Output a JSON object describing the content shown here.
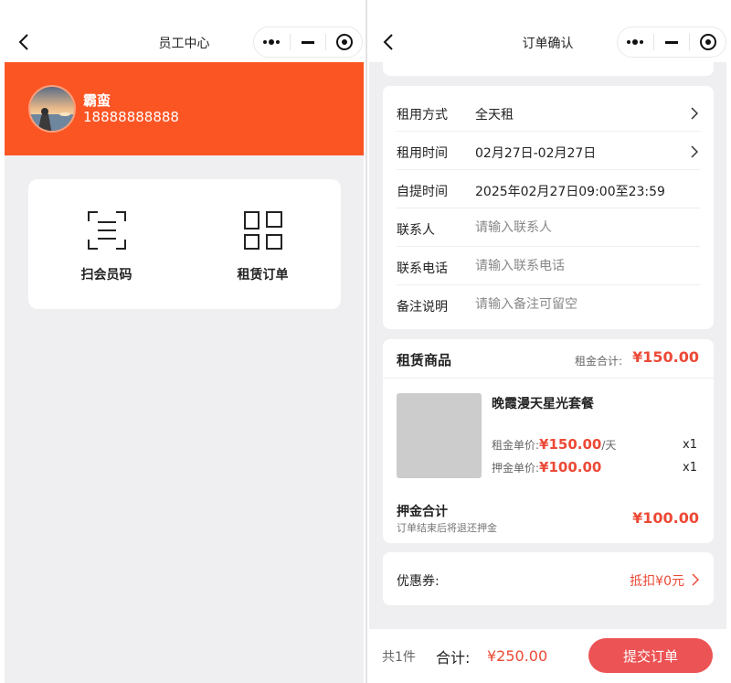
{
  "colors": {
    "brand_orange": "#fb5524",
    "accent_red": "#ec4936",
    "submit_button": "#ec5354",
    "page_background": "#efeff1"
  },
  "left_screen": {
    "nav": {
      "title": "员工中心",
      "back_icon": "chevron-left-icon",
      "capsule_icons": [
        "more-dots-icon",
        "minimize-icon",
        "target-icon"
      ]
    },
    "profile": {
      "name": "霸蛮",
      "phone": "18888888888",
      "avatar_icon": "avatar-photo"
    },
    "menu": [
      {
        "label": "扫会员码",
        "icon": "scan-icon"
      },
      {
        "label": "租赁订单",
        "icon": "grid-icon"
      }
    ]
  },
  "right_screen": {
    "nav": {
      "title": "订单确认",
      "back_icon": "chevron-left-icon",
      "capsule_icons": [
        "more-dots-icon",
        "minimize-icon",
        "target-icon"
      ]
    },
    "form": {
      "rows": [
        {
          "label": "租用方式",
          "value": "全天租",
          "has_arrow": true
        },
        {
          "label": "租用时间",
          "value": "02月27日-02月27日",
          "has_arrow": true
        },
        {
          "label": "自提时间",
          "value": "2025年02月27日09:00至23:59",
          "has_arrow": false
        }
      ],
      "inputs": [
        {
          "label": "联系人",
          "placeholder": "请输入联系人"
        },
        {
          "label": "联系电话",
          "placeholder": "请输入联系电话"
        },
        {
          "label": "备注说明",
          "placeholder": "请输入备注可留空"
        }
      ]
    },
    "goods": {
      "title": "租赁商品",
      "rent_total_label": "租金合计:",
      "rent_total": "¥150.00",
      "item": {
        "name": "晚霞漫天星光套餐",
        "rent_price_label": "租金单价:",
        "rent_price": "¥150.00",
        "rent_unit": "/天",
        "rent_qty": "x1",
        "deposit_price_label": "押金单价:",
        "deposit_price": "¥100.00",
        "deposit_qty": "x1"
      },
      "deposit_total_label": "押金合计",
      "deposit_note": "订单结束后将退还押金",
      "deposit_total": "¥100.00"
    },
    "coupon": {
      "label": "优惠券:",
      "value": "抵扣¥0元"
    },
    "footer": {
      "count": "共1件",
      "total_label": "合计:",
      "total": "¥250.00",
      "submit_label": "提交订单"
    }
  }
}
